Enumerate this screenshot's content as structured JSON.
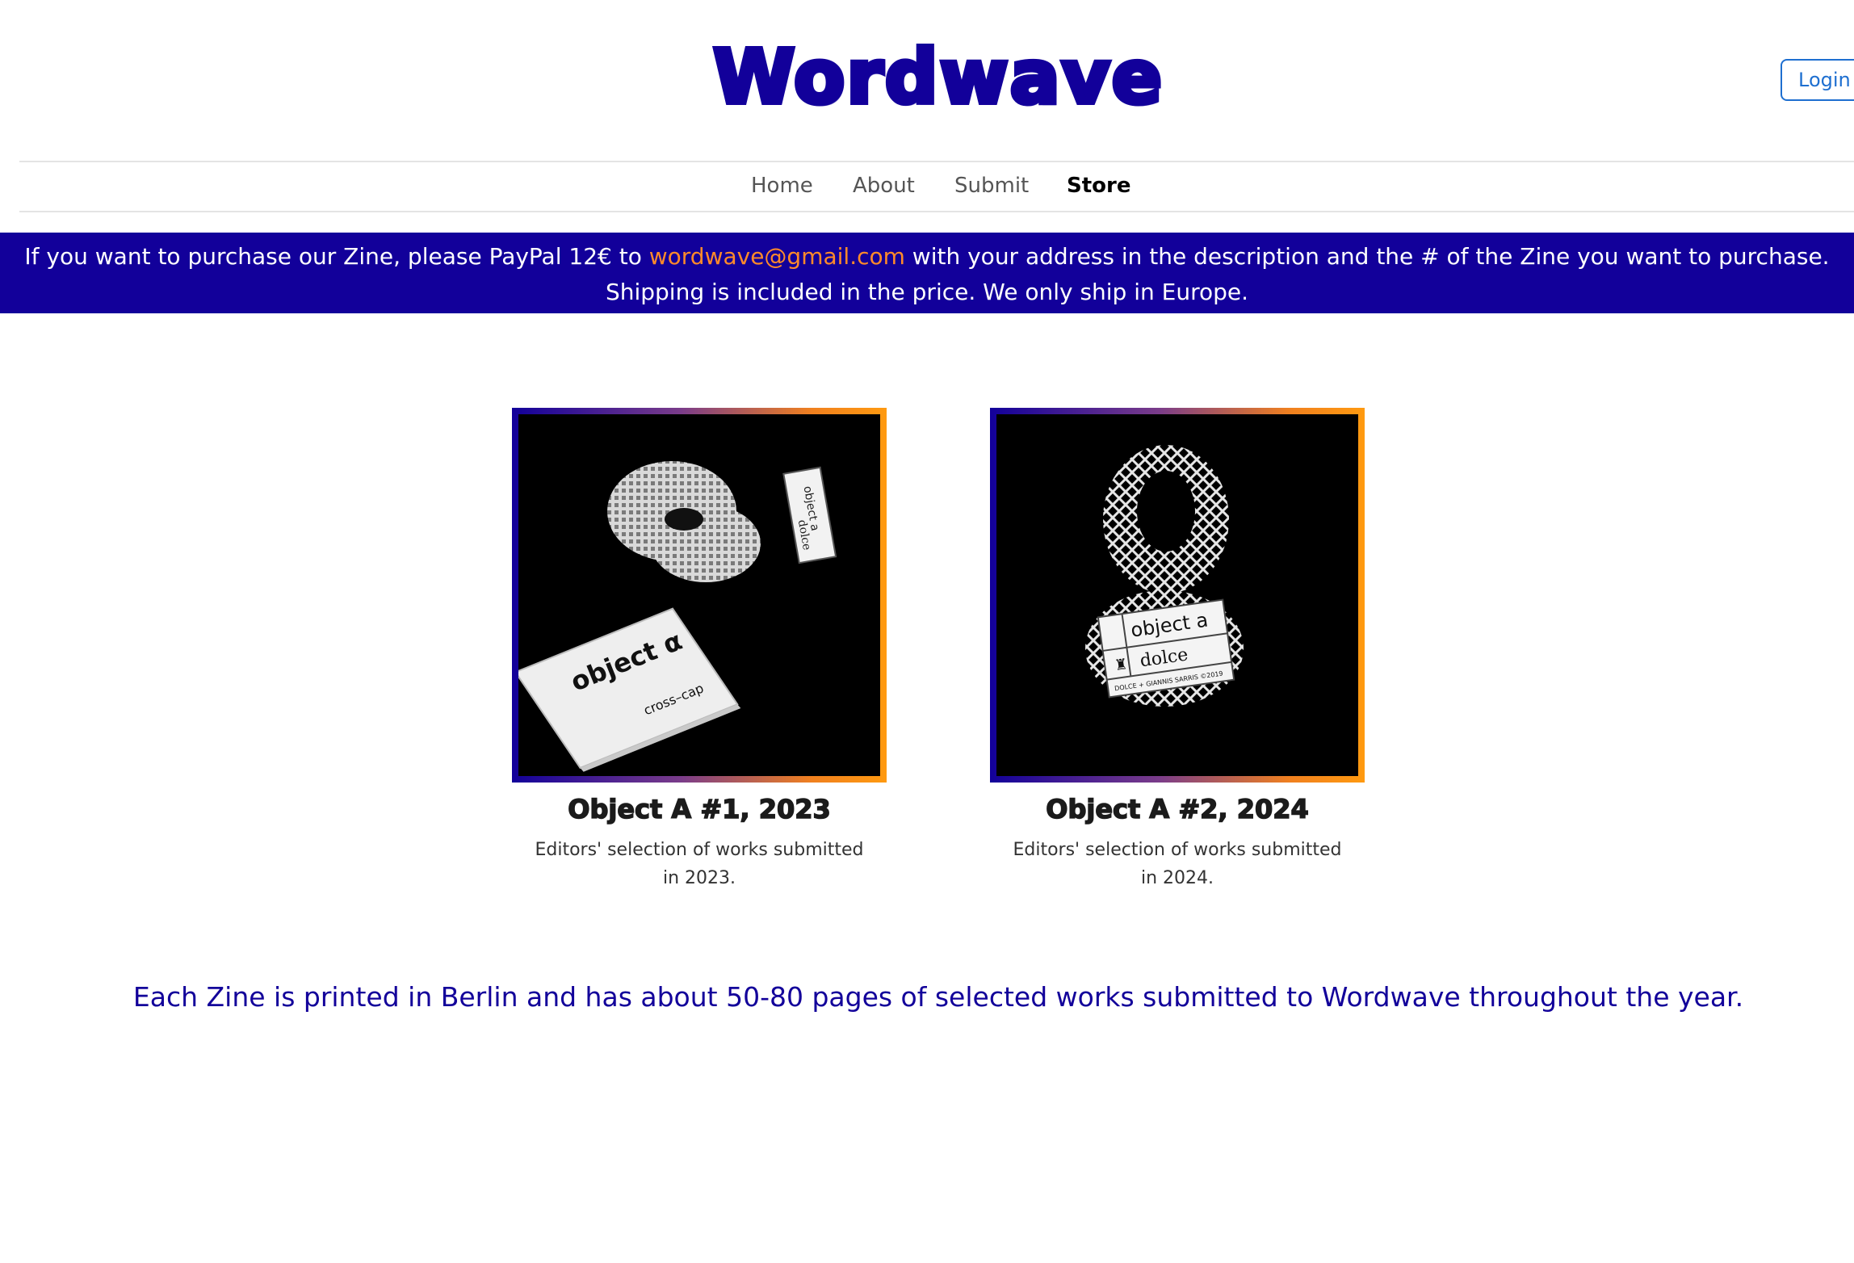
{
  "header": {
    "logo_text": "Wordwave",
    "login_label": "Login"
  },
  "nav": {
    "items": [
      {
        "label": "Home",
        "active": false
      },
      {
        "label": "About",
        "active": false
      },
      {
        "label": "Submit",
        "active": false
      },
      {
        "label": "Store",
        "active": true
      }
    ]
  },
  "banner": {
    "text_before": "If you want to purchase our Zine, please PayPal 12€ to ",
    "email": "wordwave@gmail.com",
    "text_after": " with your address in the description and the # of the Zine you want to purchase.",
    "line2": "Shipping is included in the price. We only ship in Europe."
  },
  "products": [
    {
      "title": "Object A #1, 2023",
      "description": "Editors' selection of works submitted in 2023.",
      "image_subject": "torus-sculpture-and-zine",
      "image_texts": [
        "object α",
        "cross–cap",
        "object a",
        "dolce"
      ]
    },
    {
      "title": "Object A #2, 2024",
      "description": "Editors' selection of works submitted in 2024.",
      "image_subject": "klein-bottle-sculpture",
      "image_texts": [
        "object a",
        "dolce",
        "DOLCE + GIANNIS SARRIS ©2019"
      ]
    }
  ],
  "footer": {
    "note": "Each Zine is printed in Berlin and has about 50-80 pages of selected works submitted to Wordwave throughout the year."
  },
  "colors": {
    "brand": "#12009a",
    "email_link": "#ff8a2a",
    "login_border": "#1e6fd0",
    "frame_gradient_start": "#12009a",
    "frame_gradient_end": "#ff9a10"
  }
}
